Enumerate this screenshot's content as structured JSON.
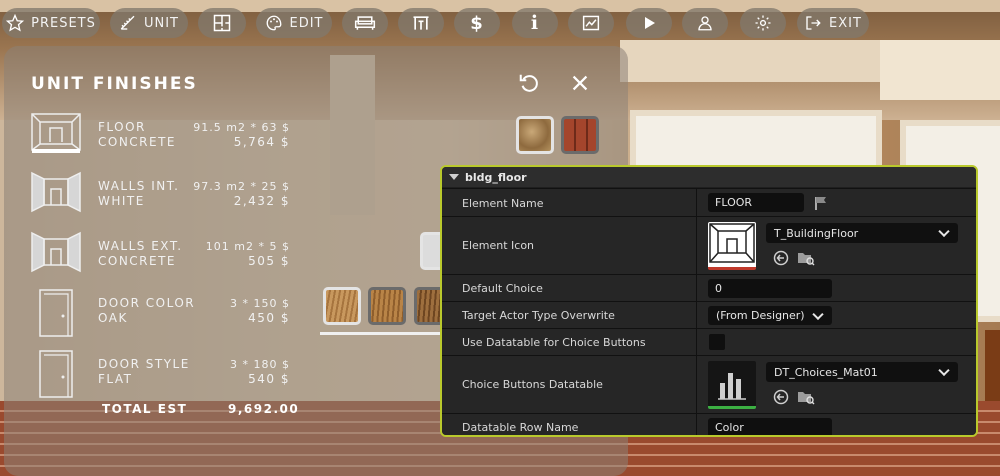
{
  "toolbar": {
    "presets_label": "PRESETS",
    "unit_label": "UNIT",
    "edit_label": "EDIT",
    "exit_label": "EXIT"
  },
  "finishes": {
    "title": "UNIT FINISHES",
    "rows": [
      {
        "name": "FLOOR",
        "material": "CONCRETE",
        "calc": "91.5 m2 * 63 $",
        "amount": "5,764 $"
      },
      {
        "name": "WALLS INT.",
        "material": "WHITE",
        "calc": "97.3 m2 * 25 $",
        "amount": "2,432 $"
      },
      {
        "name": "WALLS EXT.",
        "material": "CONCRETE",
        "calc": "101 m2 * 5 $",
        "amount": "505 $"
      },
      {
        "name": "DOOR COLOR",
        "material": "OAK",
        "calc": "3  * 150 $",
        "amount": "450 $"
      },
      {
        "name": "DOOR STYLE",
        "material": "FLAT",
        "calc": "3  * 180 $",
        "amount": "540 $"
      }
    ],
    "total_label": "TOTAL EST",
    "total_value": "9,692.00"
  },
  "details": {
    "section": "bldg_floor",
    "element_name_label": "Element Name",
    "element_name_value": "FLOOR",
    "element_icon_label": "Element Icon",
    "element_icon_value": "T_BuildingFloor",
    "default_choice_label": "Default Choice",
    "default_choice_value": "0",
    "target_actor_label": "Target Actor Type Overwrite",
    "target_actor_value": "(From Designer)",
    "use_datatable_label": "Use Datatable for Choice Buttons",
    "choice_datatable_label": "Choice Buttons Datatable",
    "choice_datatable_value": "DT_Choices_Mat01",
    "row_name_label": "Datatable Row Name",
    "row_name_value": "Color"
  },
  "colors": {
    "accent": "#b9c92c",
    "panel_bg": "#1f1f1f"
  }
}
